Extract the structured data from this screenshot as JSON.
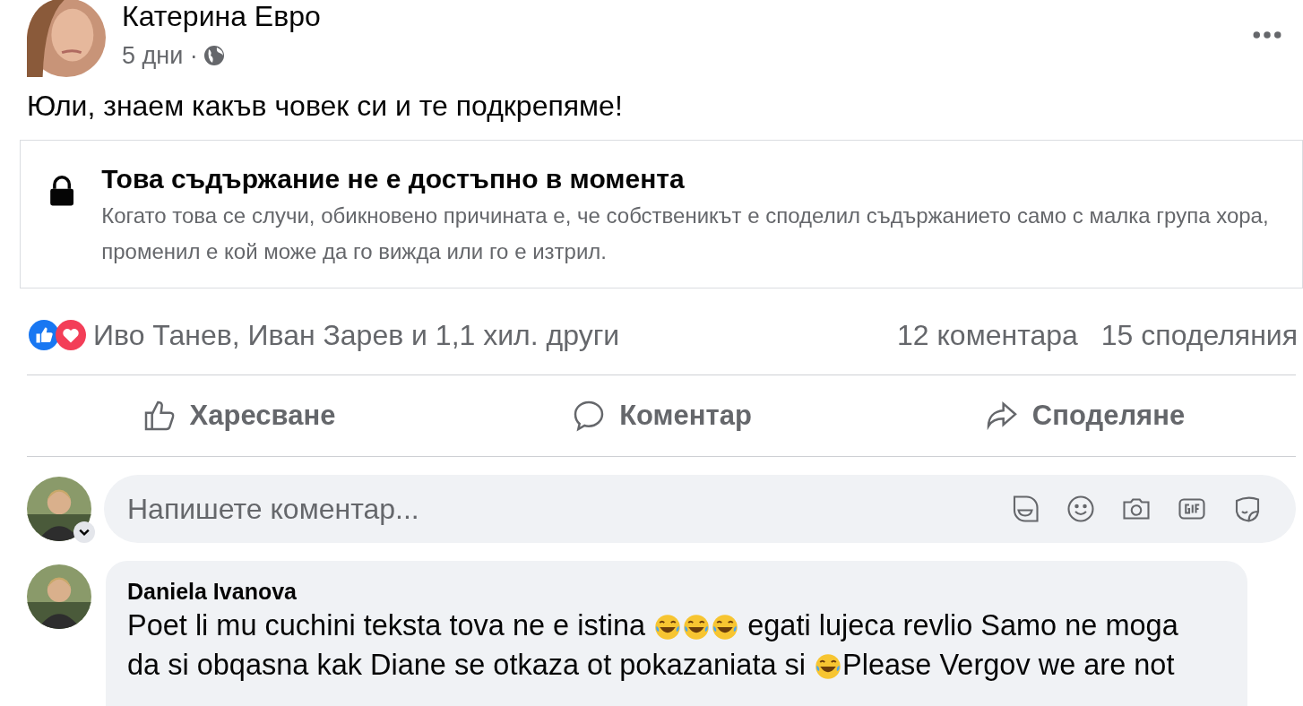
{
  "post": {
    "author": "Катерина Евро",
    "time": "5 дни ·",
    "text": "Юли, знаем какъв човек си и те подкрепяме!",
    "unavailable": {
      "title": "Това съдържание не е достъпно в момента",
      "text": "Когато това се случи, обикновено причината е, че собственикът е споделил съдържанието само с малка група хора, променил е кой може да го вижда или го е изтрил."
    },
    "reactions": "Иво Танев, Иван Зарев и 1,1 хил. други",
    "comments_count": "12 коментара",
    "shares_count": "15 споделяния",
    "actions": [
      {
        "kind": "like",
        "label": "Харесване"
      },
      {
        "kind": "comment",
        "label": "Коментар"
      },
      {
        "kind": "share",
        "label": "Споделяне"
      }
    ]
  },
  "composer": {
    "placeholder": "Напишете коментар..."
  },
  "comments": [
    {
      "author": "Daniela Ivanova",
      "segments": [
        {
          "kind": "text",
          "text": "Poet li mu cuchini teksta tova ne e istina "
        },
        {
          "kind": "emoji"
        },
        {
          "kind": "emoji"
        },
        {
          "kind": "emoji"
        },
        {
          "kind": "text",
          "text": " egati lujeca revlio Samo ne moga da si obqasna kak Diane se otkaza ot pokazaniata si "
        },
        {
          "kind": "emoji"
        },
        {
          "kind": "text",
          "text": "Please Vergov we are not"
        }
      ]
    }
  ]
}
